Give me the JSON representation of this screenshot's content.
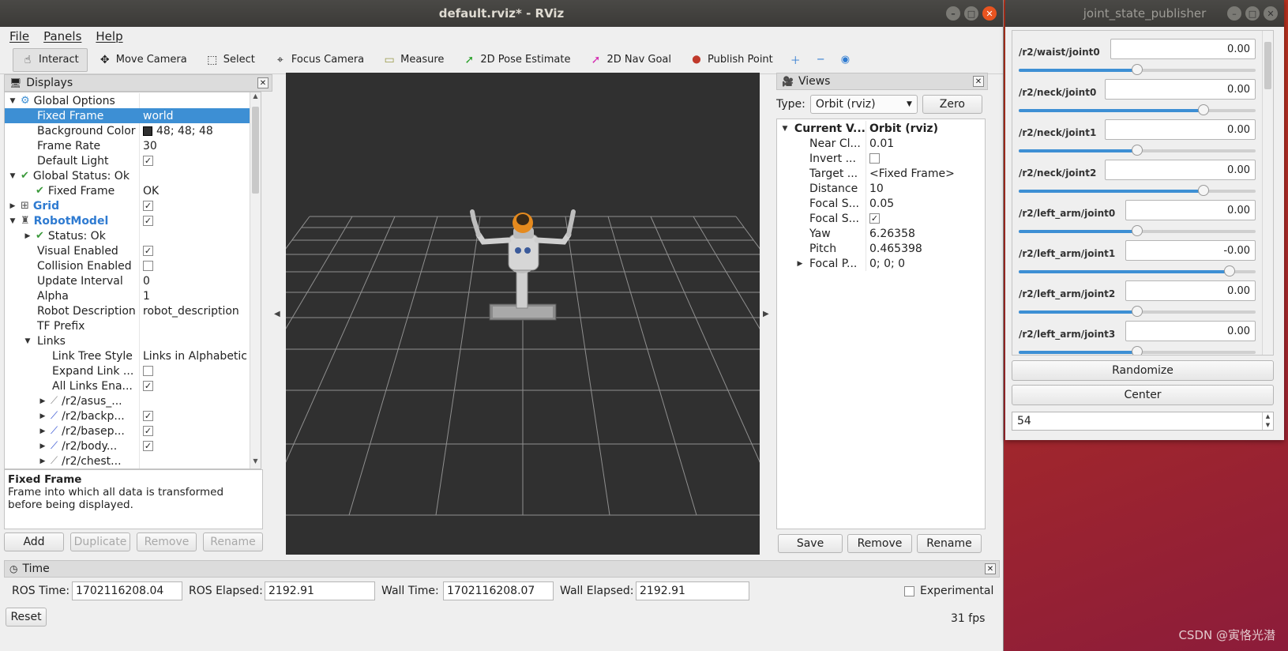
{
  "rviz": {
    "title": "default.rviz* - RViz",
    "menu": [
      "File",
      "Panels",
      "Help"
    ],
    "toolbar": [
      {
        "label": "Interact",
        "icon": "hand-icon",
        "active": true
      },
      {
        "label": "Move Camera",
        "icon": "move-camera-icon"
      },
      {
        "label": "Select",
        "icon": "select-icon"
      },
      {
        "label": "Focus Camera",
        "icon": "focus-camera-icon"
      },
      {
        "label": "Measure",
        "icon": "measure-icon"
      },
      {
        "label": "2D Pose Estimate",
        "icon": "pose-estimate-icon"
      },
      {
        "label": "2D Nav Goal",
        "icon": "nav-goal-icon"
      },
      {
        "label": "Publish Point",
        "icon": "publish-point-icon"
      }
    ],
    "displays": {
      "title": "Displays",
      "rows": [
        {
          "indent": 0,
          "arrow": "▼",
          "icon": "gear",
          "key": "Global Options",
          "value": ""
        },
        {
          "indent": 1,
          "arrow": "",
          "key": "Fixed Frame",
          "value": "world",
          "selected": true
        },
        {
          "indent": 1,
          "arrow": "",
          "key": "Background Color",
          "value": "48; 48; 48",
          "swatch": true
        },
        {
          "indent": 1,
          "arrow": "",
          "key": "Frame Rate",
          "value": "30"
        },
        {
          "indent": 1,
          "arrow": "",
          "key": "Default Light",
          "value": "",
          "checkbox": true
        },
        {
          "indent": 0,
          "arrow": "▼",
          "icon": "check",
          "key": "Global Status: Ok",
          "value": ""
        },
        {
          "indent": 1,
          "arrow": "",
          "icon": "check",
          "key": "Fixed Frame",
          "value": "OK"
        },
        {
          "indent": 0,
          "arrow": "▶",
          "icon": "grid",
          "key": "Grid",
          "value": "",
          "checkbox": true,
          "blue": true
        },
        {
          "indent": 0,
          "arrow": "▼",
          "icon": "robot",
          "key": "RobotModel",
          "value": "",
          "checkbox": true,
          "blue": true
        },
        {
          "indent": 1,
          "arrow": "▶",
          "icon": "check",
          "key": "Status: Ok",
          "value": ""
        },
        {
          "indent": 1,
          "arrow": "",
          "key": "Visual Enabled",
          "value": "",
          "checkbox": true
        },
        {
          "indent": 1,
          "arrow": "",
          "key": "Collision Enabled",
          "value": "",
          "checkbox": false
        },
        {
          "indent": 1,
          "arrow": "",
          "key": "Update Interval",
          "value": "0"
        },
        {
          "indent": 1,
          "arrow": "",
          "key": "Alpha",
          "value": "1"
        },
        {
          "indent": 1,
          "arrow": "",
          "key": "Robot Description",
          "value": "robot_description"
        },
        {
          "indent": 1,
          "arrow": "",
          "key": "TF Prefix",
          "value": ""
        },
        {
          "indent": 1,
          "arrow": "▼",
          "key": "Links",
          "value": ""
        },
        {
          "indent": 2,
          "arrow": "",
          "key": "Link Tree Style",
          "value": "Links in Alphabetic ..."
        },
        {
          "indent": 2,
          "arrow": "",
          "key": "Expand Link ...",
          "value": "",
          "checkbox": false
        },
        {
          "indent": 2,
          "arrow": "",
          "key": "All Links Ena...",
          "value": "",
          "checkbox": true
        },
        {
          "indent": 2,
          "arrow": "▶",
          "icon": "link",
          "key": "/r2/asus_...",
          "value": ""
        },
        {
          "indent": 2,
          "arrow": "▶",
          "icon": "link-blue",
          "key": "/r2/backp...",
          "value": "",
          "checkbox": true
        },
        {
          "indent": 2,
          "arrow": "▶",
          "icon": "link-blue",
          "key": "/r2/basep...",
          "value": "",
          "checkbox": true
        },
        {
          "indent": 2,
          "arrow": "▶",
          "icon": "link-blue",
          "key": "/r2/body...",
          "value": "",
          "checkbox": true
        },
        {
          "indent": 2,
          "arrow": "▶",
          "icon": "link",
          "key": "/r2/chest...",
          "value": ""
        },
        {
          "indent": 2,
          "arrow": "▶",
          "icon": "link",
          "key": "/r2/chest...",
          "value": ""
        }
      ],
      "description_title": "Fixed Frame",
      "description_text": "Frame into which all data is transformed before being displayed.",
      "buttons": {
        "add": "Add",
        "duplicate": "Duplicate",
        "remove": "Remove",
        "rename": "Rename"
      }
    },
    "views": {
      "title": "Views",
      "type_label": "Type:",
      "type_value": "Orbit (rviz)",
      "zero": "Zero",
      "rows": [
        {
          "indent": 0,
          "arrow": "▼",
          "key": "Current V...",
          "value": "Orbit (rviz)",
          "bold": true
        },
        {
          "indent": 1,
          "arrow": "",
          "key": "Near Cl...",
          "value": "0.01"
        },
        {
          "indent": 1,
          "arrow": "",
          "key": "Invert ...",
          "value": "",
          "checkbox": false
        },
        {
          "indent": 1,
          "arrow": "",
          "key": "Target ...",
          "value": "<Fixed Frame>"
        },
        {
          "indent": 1,
          "arrow": "",
          "key": "Distance",
          "value": "10"
        },
        {
          "indent": 1,
          "arrow": "",
          "key": "Focal S...",
          "value": "0.05"
        },
        {
          "indent": 1,
          "arrow": "",
          "key": "Focal S...",
          "value": "",
          "checkbox": true
        },
        {
          "indent": 1,
          "arrow": "",
          "key": "Yaw",
          "value": "6.26358"
        },
        {
          "indent": 1,
          "arrow": "",
          "key": "Pitch",
          "value": "0.465398"
        },
        {
          "indent": 1,
          "arrow": "▶",
          "key": "Focal P...",
          "value": "0; 0; 0"
        }
      ],
      "buttons": {
        "save": "Save",
        "remove": "Remove",
        "rename": "Rename"
      }
    },
    "time": {
      "title": "Time",
      "ros_time_label": "ROS Time:",
      "ros_time": "1702116208.04",
      "ros_elapsed_label": "ROS Elapsed:",
      "ros_elapsed": "2192.91",
      "wall_time_label": "Wall Time:",
      "wall_time": "1702116208.07",
      "wall_elapsed_label": "Wall Elapsed:",
      "wall_elapsed": "2192.91",
      "experimental": "Experimental",
      "reset": "Reset",
      "fps": "31 fps"
    }
  },
  "jsp": {
    "title": "joint_state_publisher",
    "joints": [
      {
        "name": "/r2/waist/joint0",
        "value": "0.00",
        "level": 0.5
      },
      {
        "name": "/r2/neck/joint0",
        "value": "0.00",
        "level": 0.78
      },
      {
        "name": "/r2/neck/joint1",
        "value": "0.00",
        "level": 0.5
      },
      {
        "name": "/r2/neck/joint2",
        "value": "0.00",
        "level": 0.78
      },
      {
        "name": "/r2/left_arm/joint0",
        "value": "0.00",
        "level": 0.5
      },
      {
        "name": "/r2/left_arm/joint1",
        "value": "-0.00",
        "level": 0.89
      },
      {
        "name": "/r2/left_arm/joint2",
        "value": "0.00",
        "level": 0.5
      },
      {
        "name": "/r2/left_arm/joint3",
        "value": "0.00",
        "level": 0.5
      }
    ],
    "randomize": "Randomize",
    "center": "Center",
    "spin_value": "54"
  },
  "watermark": "CSDN @寅恪光潜",
  "colors": {
    "accent": "#3d8fd4",
    "viewport_bg": "#303030",
    "close": "#e95420"
  }
}
